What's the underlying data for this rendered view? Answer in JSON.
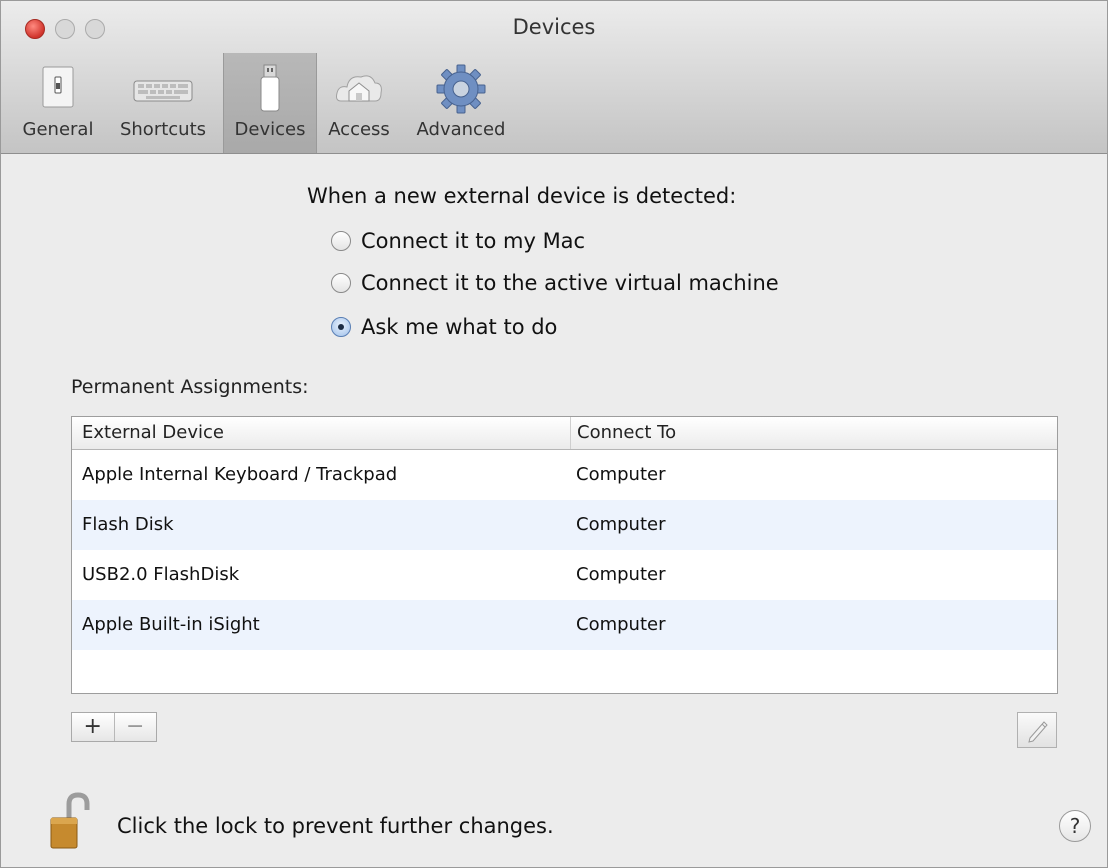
{
  "window": {
    "title": "Devices"
  },
  "toolbar": {
    "tabs": [
      {
        "label": "General",
        "icon": "general-switch-icon"
      },
      {
        "label": "Shortcuts",
        "icon": "keyboard-icon"
      },
      {
        "label": "Devices",
        "icon": "usb-device-icon",
        "selected": true
      },
      {
        "label": "Access",
        "icon": "house-cloud-icon"
      },
      {
        "label": "Advanced",
        "icon": "gear-icon"
      }
    ]
  },
  "detection": {
    "prompt": "When a new external device is detected:",
    "options": [
      {
        "label": "Connect it to my Mac",
        "selected": false
      },
      {
        "label": "Connect it to the active virtual machine",
        "selected": false
      },
      {
        "label": "Ask me what to do",
        "selected": true
      }
    ]
  },
  "assignments": {
    "label": "Permanent Assignments:",
    "columns": [
      "External Device",
      "Connect To"
    ],
    "rows": [
      {
        "device": "Apple Internal Keyboard / Trackpad",
        "connect_to": "Computer"
      },
      {
        "device": "Flash Disk",
        "connect_to": "Computer"
      },
      {
        "device": "USB2.0 FlashDisk",
        "connect_to": "Computer"
      },
      {
        "device": "Apple Built-in iSight",
        "connect_to": "Computer"
      }
    ]
  },
  "buttons": {
    "add": "+",
    "remove": "−",
    "help": "?"
  },
  "footer": {
    "lock_text": "Click the lock to prevent further changes."
  }
}
